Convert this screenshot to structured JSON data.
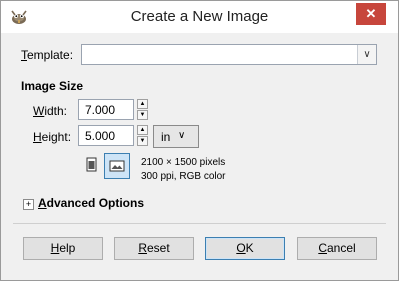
{
  "window": {
    "title": "Create a New Image",
    "close_glyph": "✕",
    "icon": "gimp-wilber-icon"
  },
  "template": {
    "label_first": "T",
    "label_rest": "emplate:",
    "value": ""
  },
  "image_size": {
    "section_label": "Image Size",
    "width_label_first": "W",
    "width_label_rest": "idth:",
    "width_value": "7.000",
    "height_label_first": "H",
    "height_label_rest": "eight:",
    "height_value": "5.000",
    "unit": "in",
    "info_line1": "2100 × 1500 pixels",
    "info_line2": "300 ppi, RGB color",
    "orientation_selected": "landscape"
  },
  "advanced": {
    "expander": "+",
    "label_first": "A",
    "label_rest": "dvanced Options"
  },
  "buttons": {
    "help_first": "H",
    "help_rest": "elp",
    "reset_first": "R",
    "reset_rest": "eset",
    "ok_first": "O",
    "ok_rest": "K",
    "cancel_first": "C",
    "cancel_rest": "ancel"
  },
  "colors": {
    "close_bg": "#c7463c",
    "selected_toggle": "#cde4f7",
    "focus_border": "#3c7fb1"
  }
}
